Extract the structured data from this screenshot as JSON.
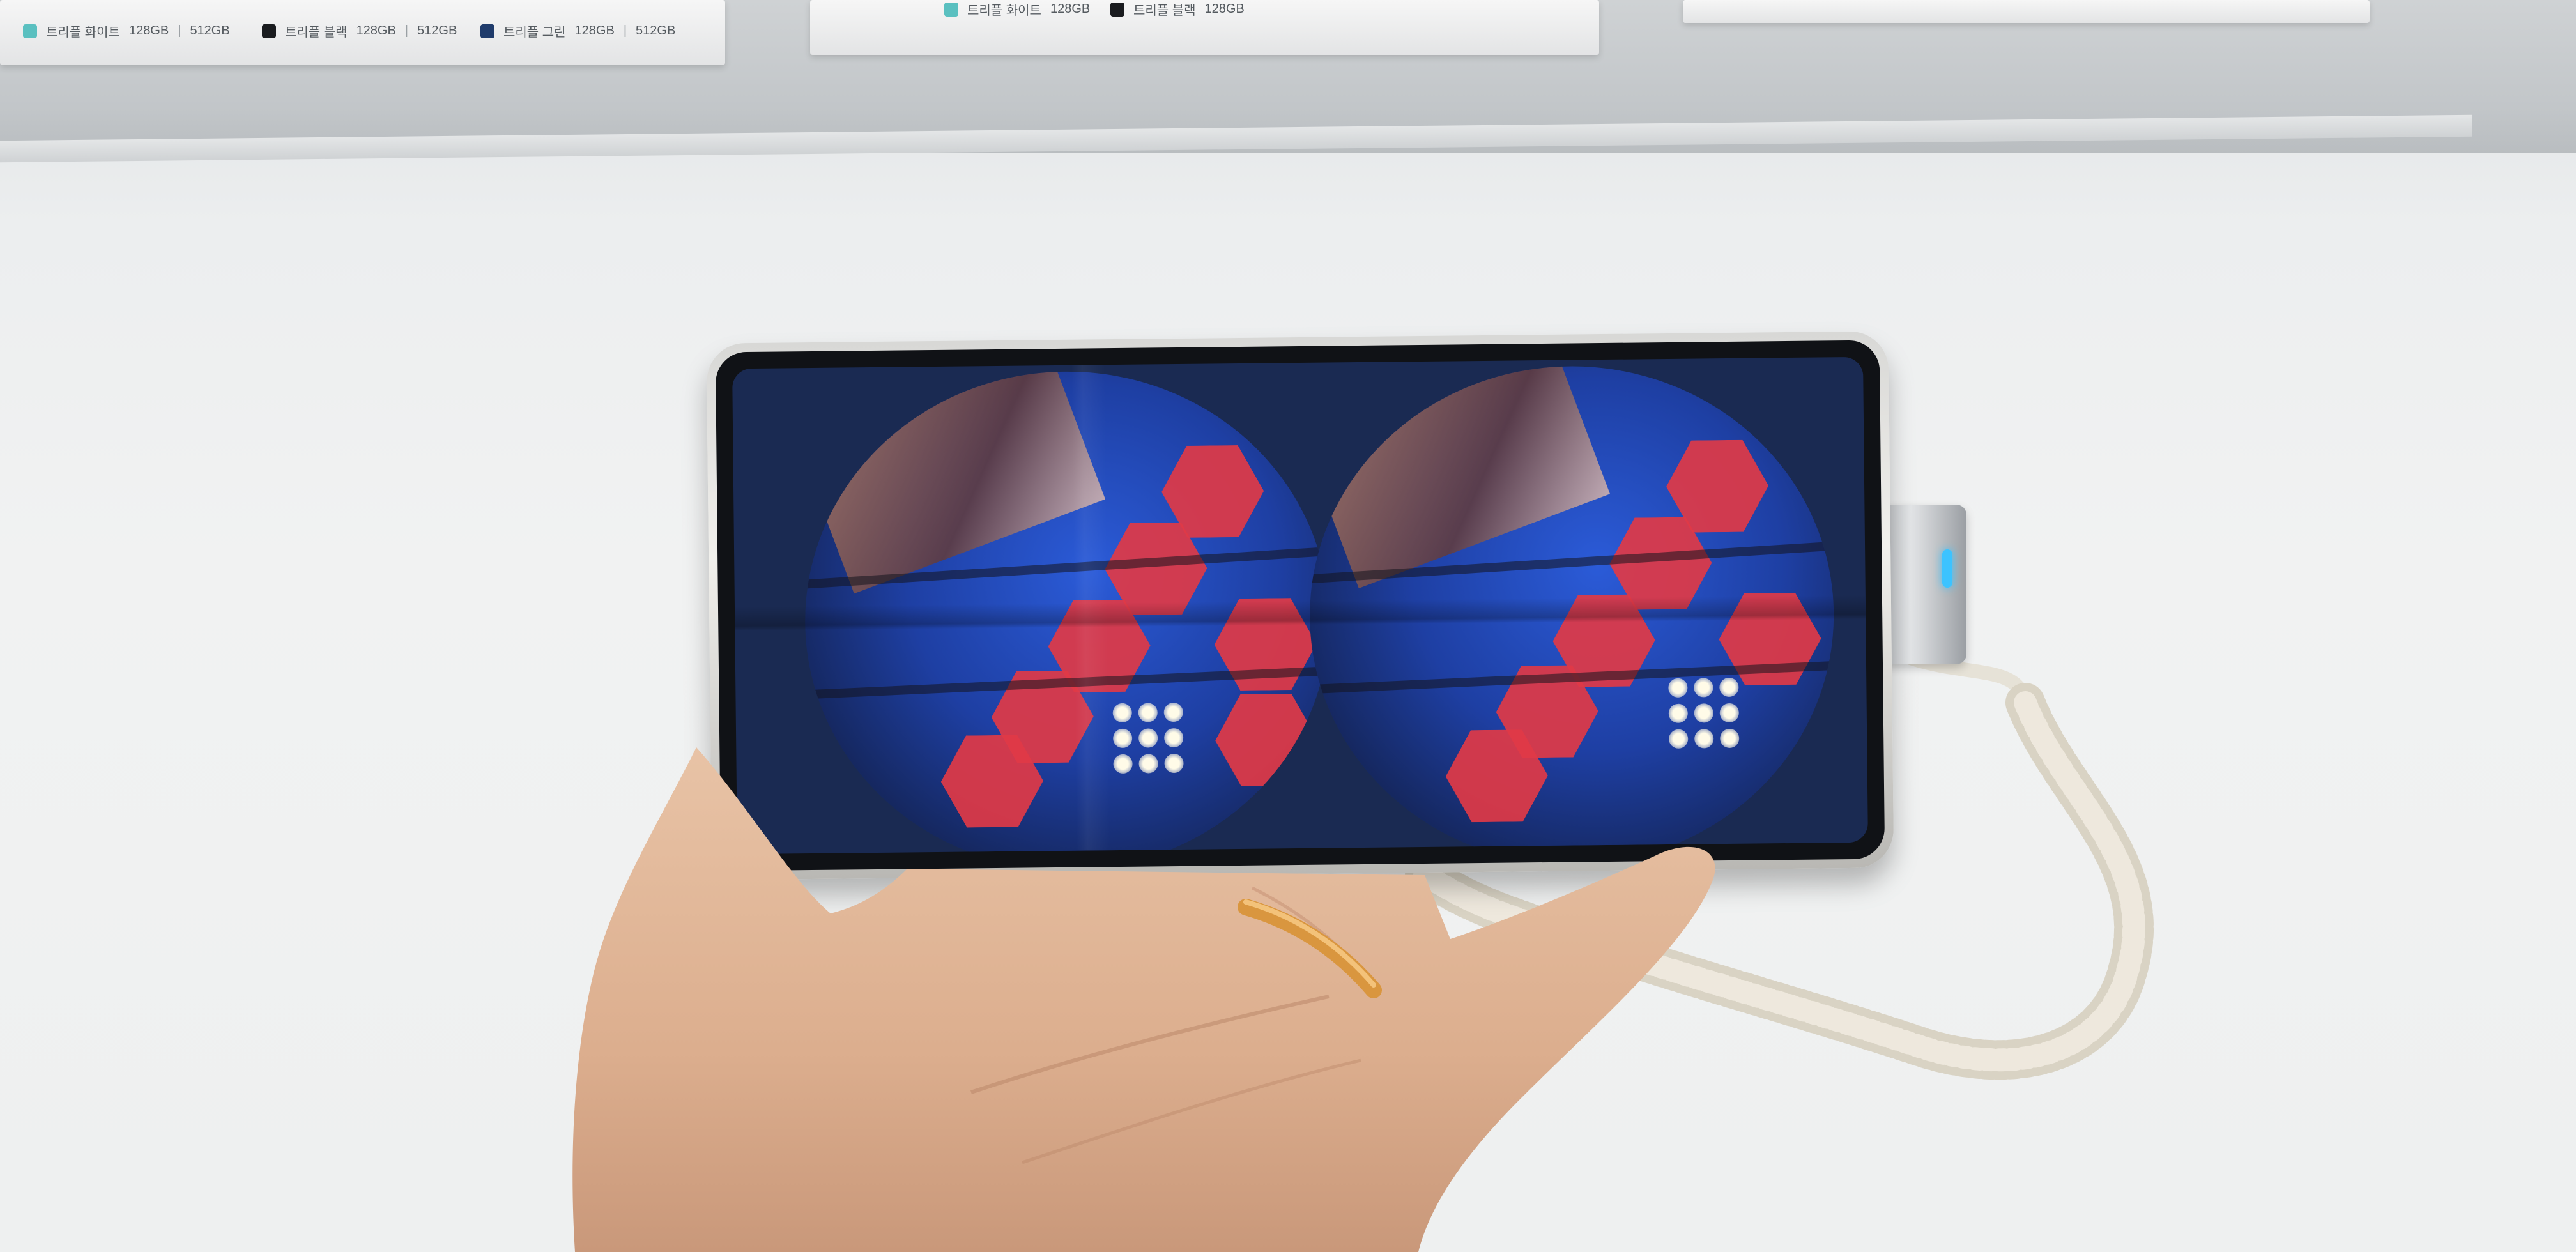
{
  "shelf": {
    "cards": [
      {
        "variants": [
          {
            "name": "트리플 화이트",
            "storage_a": "128GB",
            "storage_b": "512GB",
            "color": "#5ac0c0"
          },
          {
            "name": "트리플 블랙",
            "storage_a": "128GB",
            "storage_b": "512GB",
            "color": "#1a1c1f"
          },
          {
            "name": "트리플 그린",
            "storage_a": "128GB",
            "storage_b": "512GB",
            "color": "#1f3b6b"
          }
        ]
      },
      {
        "variants": [
          {
            "name": "트리플 화이트",
            "storage_a": "128GB",
            "color": "#5ac0c0"
          },
          {
            "name": "트리플 블랙",
            "storage_a": "128GB",
            "color": "#1a1c1f"
          }
        ]
      }
    ]
  },
  "device": {
    "screen_content": "stereoscopic-vr-view",
    "accent_led_color": "#3cc3ff"
  }
}
